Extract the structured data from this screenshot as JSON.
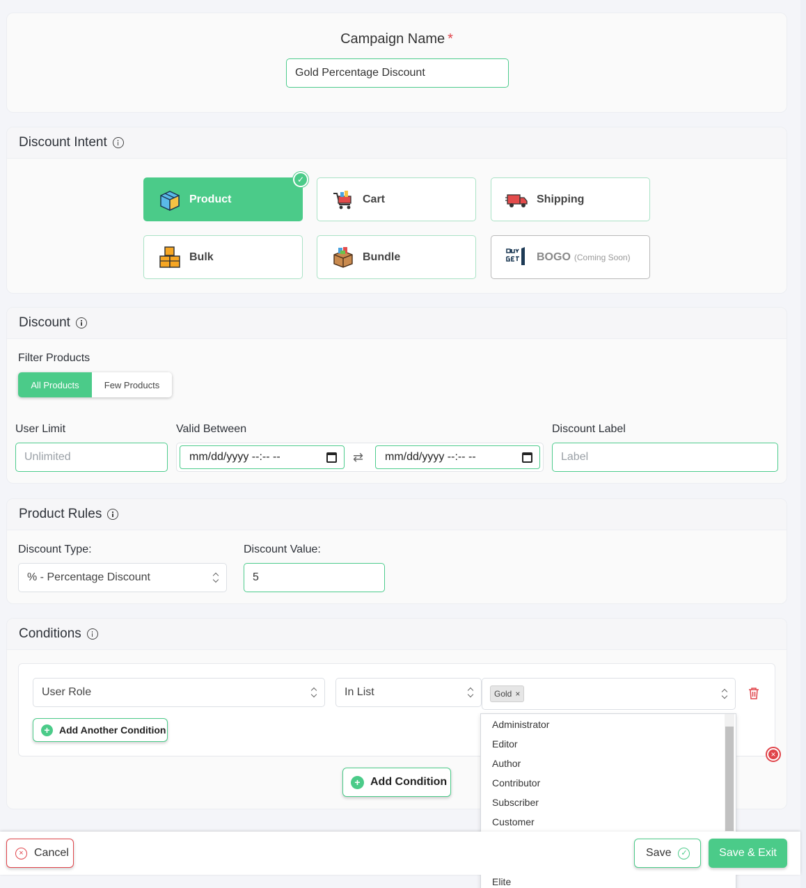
{
  "campaign": {
    "label": "Campaign Name",
    "required_mark": "*",
    "value": "Gold Percentage Discount"
  },
  "intent": {
    "title": "Discount Intent",
    "tiles": [
      {
        "label": "Product",
        "icon": "product-box-icon",
        "selected": true
      },
      {
        "label": "Cart",
        "icon": "cart-icon"
      },
      {
        "label": "Shipping",
        "icon": "truck-icon"
      },
      {
        "label": "Bulk",
        "icon": "boxes-icon"
      },
      {
        "label": "Bundle",
        "icon": "bundle-box-icon"
      },
      {
        "label": "BOGO",
        "note": "(Coming Soon)",
        "icon": "buy-get-icon",
        "disabled": true
      }
    ]
  },
  "discount": {
    "title": "Discount",
    "filter_label": "Filter Products",
    "filter_options": [
      "All Products",
      "Few Products"
    ],
    "filter_selected": "All Products",
    "user_limit_label": "User Limit",
    "user_limit_placeholder": "Unlimited",
    "valid_label": "Valid Between",
    "date_from": "mm/dd/yyyy --:-- --",
    "date_to": "mm/dd/yyyy --:-- --",
    "label_label": "Discount Label",
    "label_placeholder": "Label"
  },
  "rules": {
    "title": "Product Rules",
    "type_label": "Discount Type:",
    "type_value": "% - Percentage Discount",
    "value_label": "Discount Value:",
    "value": "5"
  },
  "conditions": {
    "title": "Conditions",
    "field": "User Role",
    "operator": "In List",
    "tags": [
      "Gold"
    ],
    "add_another": "Add Another Condition",
    "add_condition": "Add Condition",
    "options": [
      "Administrator",
      "Editor",
      "Author",
      "Contributor",
      "Subscriber",
      "Customer"
    ],
    "partial_option": "Elite"
  },
  "footer": {
    "cancel": "Cancel",
    "save": "Save",
    "save_exit": "Save & Exit"
  },
  "colors": {
    "accent": "#4bcb89",
    "danger": "#e0444a"
  }
}
